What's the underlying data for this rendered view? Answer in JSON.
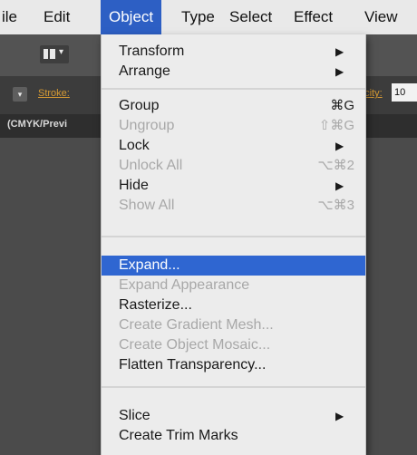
{
  "menubar": {
    "items": [
      {
        "label": "ile"
      },
      {
        "label": "Edit"
      },
      {
        "label": "Object"
      },
      {
        "label": "Type"
      },
      {
        "label": "Select"
      },
      {
        "label": "Effect"
      },
      {
        "label": "View"
      }
    ]
  },
  "control_bar": {
    "stroke_label": "Stroke:",
    "opacity_label": "acity:",
    "opacity_value": "10"
  },
  "document_tab": {
    "label": "(CMYK/Previ"
  },
  "object_menu": {
    "items": [
      {
        "label": "Transform",
        "submenu": "▶"
      },
      {
        "label": "Arrange",
        "submenu": "▶"
      },
      {
        "label": "Group",
        "shortcut": "⌘G"
      },
      {
        "label": "Ungroup",
        "shortcut": "⇧⌘G"
      },
      {
        "label": "Lock",
        "submenu": "▶"
      },
      {
        "label": "Unlock All",
        "shortcut": "⌥⌘2"
      },
      {
        "label": "Hide",
        "submenu": "▶"
      },
      {
        "label": "Show All",
        "shortcut": "⌥⌘3"
      },
      {
        "label": "Expand..."
      },
      {
        "label": "Expand Appearance"
      },
      {
        "label": "Rasterize..."
      },
      {
        "label": "Create Gradient Mesh..."
      },
      {
        "label": "Create Object Mosaic..."
      },
      {
        "label": "Flatten Transparency..."
      },
      {
        "label": "Slice",
        "submenu": "▶"
      },
      {
        "label": "Create Trim Marks"
      }
    ]
  }
}
